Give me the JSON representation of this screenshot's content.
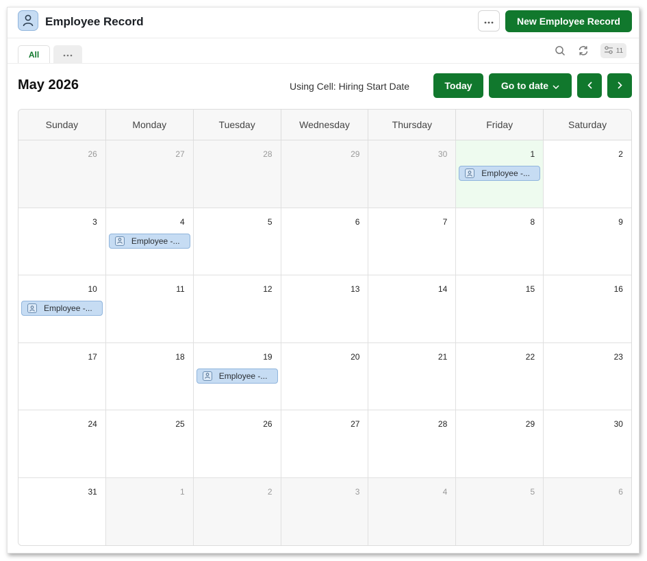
{
  "header": {
    "title": "Employee Record",
    "app_icon": "person-icon",
    "more_icon": "ellipsis-icon",
    "new_button_label": "New Employee Record"
  },
  "tabs": {
    "items": [
      {
        "label": "All",
        "active": true
      },
      {
        "label": "",
        "icon": "ellipsis-icon"
      }
    ],
    "tools": {
      "search_icon": "search-icon",
      "refresh_icon": "refresh-icon",
      "filter_icon": "sliders-icon",
      "filter_count": "11"
    }
  },
  "toolbar": {
    "month_title": "May 2026",
    "using_cell_label": "Using Cell: Hiring Start Date",
    "today_label": "Today",
    "goto_label": "Go to date",
    "prev_icon": "chevron-left-icon",
    "next_icon": "chevron-right-icon"
  },
  "calendar": {
    "weekdays": [
      "Sunday",
      "Monday",
      "Tuesday",
      "Wednesday",
      "Thursday",
      "Friday",
      "Saturday"
    ],
    "weeks": [
      [
        {
          "day": "26",
          "other": true
        },
        {
          "day": "27",
          "other": true
        },
        {
          "day": "28",
          "other": true
        },
        {
          "day": "29",
          "other": true
        },
        {
          "day": "30",
          "other": true
        },
        {
          "day": "1",
          "today": true,
          "event": "Employee -..."
        },
        {
          "day": "2"
        }
      ],
      [
        {
          "day": "3"
        },
        {
          "day": "4",
          "event": "Employee -..."
        },
        {
          "day": "5"
        },
        {
          "day": "6"
        },
        {
          "day": "7"
        },
        {
          "day": "8"
        },
        {
          "day": "9"
        }
      ],
      [
        {
          "day": "10",
          "event": "Employee -..."
        },
        {
          "day": "11"
        },
        {
          "day": "12"
        },
        {
          "day": "13"
        },
        {
          "day": "14"
        },
        {
          "day": "15"
        },
        {
          "day": "16"
        }
      ],
      [
        {
          "day": "17"
        },
        {
          "day": "18"
        },
        {
          "day": "19",
          "event": "Employee -..."
        },
        {
          "day": "20"
        },
        {
          "day": "21"
        },
        {
          "day": "22"
        },
        {
          "day": "23"
        }
      ],
      [
        {
          "day": "24"
        },
        {
          "day": "25"
        },
        {
          "day": "26"
        },
        {
          "day": "27"
        },
        {
          "day": "28"
        },
        {
          "day": "29"
        },
        {
          "day": "30"
        }
      ],
      [
        {
          "day": "31"
        },
        {
          "day": "1",
          "other": true
        },
        {
          "day": "2",
          "other": true
        },
        {
          "day": "3",
          "other": true
        },
        {
          "day": "4",
          "other": true
        },
        {
          "day": "5",
          "other": true
        },
        {
          "day": "6",
          "other": true
        }
      ]
    ]
  },
  "colors": {
    "accent_green": "#11782d",
    "event_blue": "#c6dcf3",
    "today_bg": "#eefbef"
  }
}
